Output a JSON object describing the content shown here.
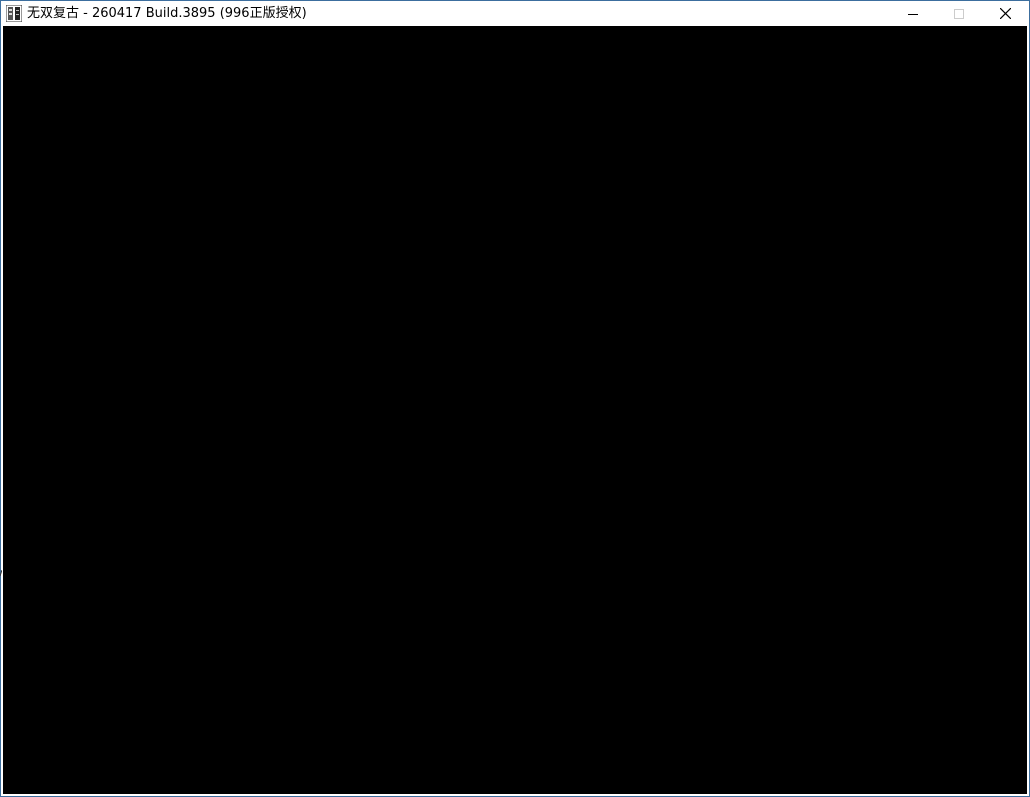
{
  "window": {
    "title": "无双复古 - 260417 Build.3895 (996正版授权)",
    "icon": "app-logo-icon",
    "controls": {
      "minimize_icon": "minimize-icon",
      "maximize_icon": "maximize-icon",
      "close_icon": "close-icon"
    }
  },
  "content": {
    "background": "#000000"
  },
  "colors": {
    "titlebar_bg": "#ffffff",
    "frame_border": "#3c6e9e",
    "title_text": "#000000"
  }
}
